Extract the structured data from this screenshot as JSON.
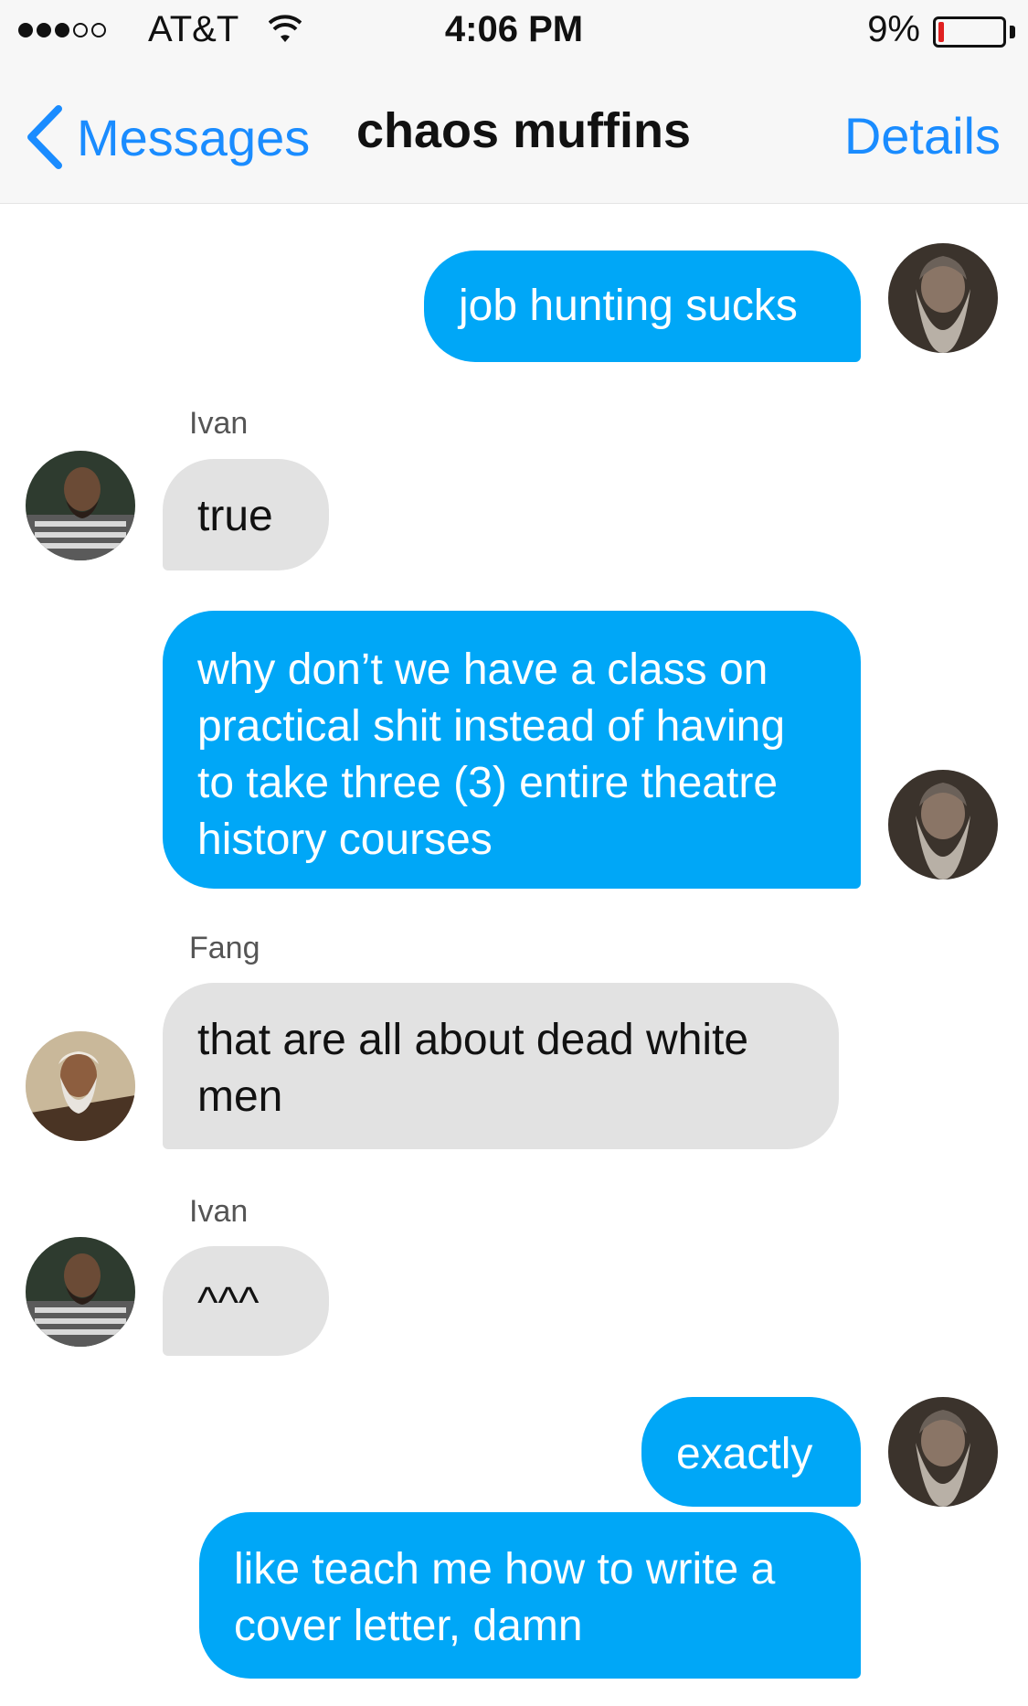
{
  "status_bar": {
    "signal_filled": 3,
    "signal_empty": 2,
    "carrier": "AT&T",
    "time": "4:06 PM",
    "battery": "9%",
    "battery_level": 0.09,
    "icons": [
      "signal-dots-icon",
      "wifi-icon",
      "battery-icon"
    ]
  },
  "nav": {
    "back_label": "Messages",
    "title": "chaos muffins",
    "details_label": "Details"
  },
  "colors": {
    "outgoing_bubble": "#00a7f7",
    "incoming_bubble": "#e2e2e2",
    "accent": "#1a8cff"
  },
  "messages": [
    {
      "direction": "outgoing",
      "text": "job hunting sucks"
    },
    {
      "direction": "incoming",
      "sender": "Ivan",
      "text": "true"
    },
    {
      "direction": "outgoing",
      "text": "why don’t we have a class on practical shit instead of having to take three (3) entire theatre history courses"
    },
    {
      "direction": "incoming",
      "sender": "Fang",
      "text": "that are all about dead white men"
    },
    {
      "direction": "incoming",
      "sender": "Ivan",
      "text": "^^^"
    },
    {
      "direction": "outgoing",
      "text": "exactly"
    },
    {
      "direction": "outgoing",
      "text": "like teach me how to write a cover letter, damn"
    }
  ]
}
